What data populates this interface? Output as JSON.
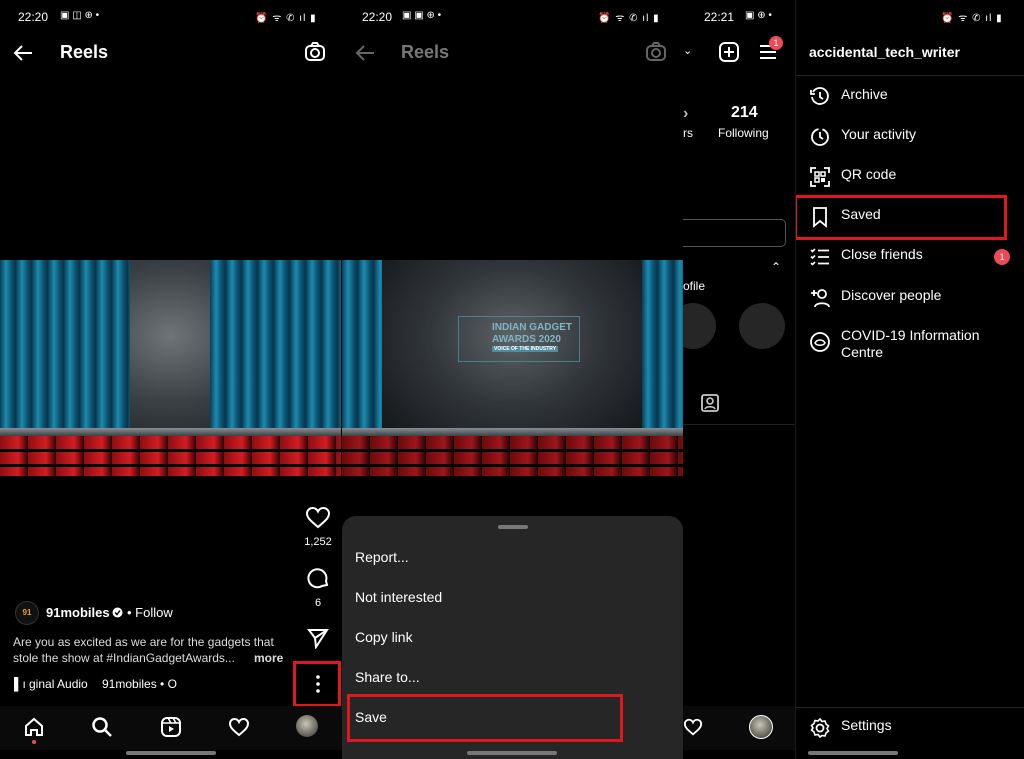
{
  "panel1": {
    "status_time": "22:20",
    "status_right": "⏰ ᯤ ✆ ıl ▮",
    "title": "Reels",
    "like_count": "1,252",
    "comment_count": "6",
    "author_avatar_text": "91",
    "author_name": "91mobiles",
    "author_follow": "• Follow",
    "caption_line1": "Are you as excited as we are for the gadgets that",
    "caption_line2": "stole the show at #IndianGadgetAwards...",
    "caption_more": "more",
    "audio_text": "ginal Audio",
    "audio_author": "91mobiles • O",
    "nav": [
      "home-icon",
      "search-icon",
      "reels-icon",
      "heart-icon",
      "profile-avatar"
    ]
  },
  "panel2": {
    "status_time": "22:20",
    "status_right": "⏰ ᯤ ✆ ıl ▮",
    "title": "Reels",
    "video_logo_line1": "INDIAN GADGET",
    "video_logo_line2": "AWARDS 2020",
    "video_logo_line3": "VOICE OF THE INDUSTRY",
    "sheet_items": [
      "Report...",
      "Not interested",
      "Copy link",
      "Share to...",
      "Save"
    ]
  },
  "panel3": {
    "status_time": "22:21",
    "menu_badge": "1",
    "followers_partial": "rs",
    "following_count": "214",
    "following_label": "Following",
    "profile_partial": "ofile"
  },
  "panel4": {
    "status_right": "⏰ ᯤ ✆ ıl ▮",
    "username": "accidental_tech_writer",
    "menu": [
      {
        "label": "Archive",
        "icon": "archive-icon"
      },
      {
        "label": "Your activity",
        "icon": "activity-icon"
      },
      {
        "label": "QR code",
        "icon": "qr-code-icon"
      },
      {
        "label": "Saved",
        "icon": "bookmark-icon"
      },
      {
        "label": "Close friends",
        "icon": "close-friends-icon",
        "badge": "1"
      },
      {
        "label": "Discover people",
        "icon": "add-person-icon"
      },
      {
        "label": "COVID-19 Information",
        "label2": "Centre",
        "icon": "covid-info-icon"
      }
    ],
    "settings_label": "Settings"
  },
  "colors": {
    "highlight": "#e0181e",
    "badge": "#ed4956",
    "sheet": "#262626"
  }
}
